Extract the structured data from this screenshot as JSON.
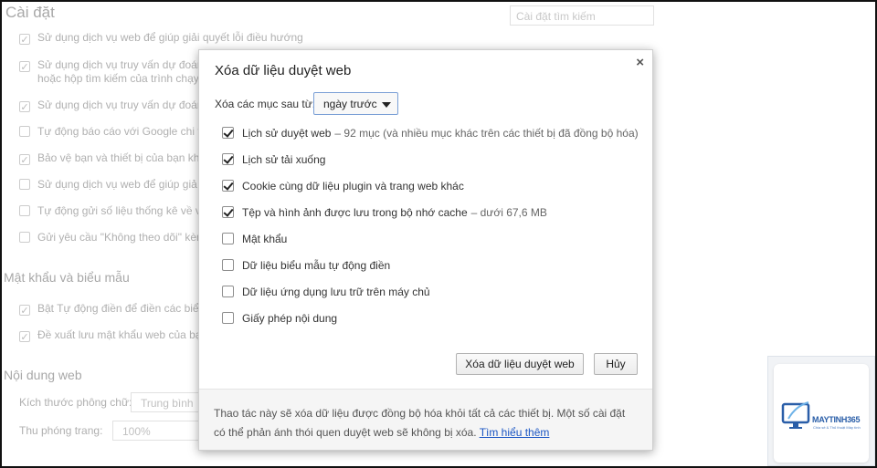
{
  "background": {
    "title": "Cài đặt",
    "search_placeholder": "Cài đặt tìm kiếm",
    "privacy_rows": [
      {
        "label": "Sử dụng dịch vụ web để giúp giải quyết lỗi điều hướng",
        "checked": true
      },
      {
        "label": "Sử dụng dịch vụ truy vấn dự đoán",
        "line2": "hoặc hộp tìm kiếm của trình chạy",
        "checked": true
      },
      {
        "label": "Sử dụng dịch vụ truy vấn dự đoán",
        "checked": true
      },
      {
        "label": "Tự động báo cáo với Google chi t",
        "checked": false
      },
      {
        "label": "Bảo vệ bạn và thiết bị của bạn kh",
        "checked": true
      },
      {
        "label": "Sử dụng dịch vụ web để giúp giả",
        "checked": false
      },
      {
        "label": "Tự động gửi số liệu thống kê về v",
        "checked": false
      },
      {
        "label": "Gửi yêu cầu \"Không theo dõi\" kèm",
        "checked": false
      }
    ],
    "passwords_heading": "Mật khẩu và biểu mẫu",
    "password_rows": [
      {
        "label": "Bật Tự động điền để điền các biể",
        "checked": true
      },
      {
        "label": "Đề xuất lưu mật khẩu web của bạ",
        "checked": true
      }
    ],
    "web_content_heading": "Nội dung web",
    "font_size_label": "Kích thước phông chữ:",
    "font_size_value": "Trung bình",
    "zoom_label": "Thu phóng trang:",
    "zoom_value": "100%"
  },
  "dialog": {
    "title": "Xóa dữ liệu duyệt web",
    "close_glyph": "×",
    "since_label": "Xóa các mục sau từ:",
    "since_value": "ngày trước",
    "options": [
      {
        "label": "Lịch sử duyệt web",
        "extra": "–  92 mục (và nhiều mục khác trên các thiết bị đã đồng bộ hóa)",
        "checked": true
      },
      {
        "label": "Lịch sử tải xuống",
        "extra": "",
        "checked": true
      },
      {
        "label": "Cookie cùng dữ liệu plugin và trang web khác",
        "extra": "",
        "checked": true
      },
      {
        "label": "Tệp và hình ảnh được lưu trong bộ nhớ cache",
        "extra": "–  dưới 67,6 MB",
        "checked": true
      },
      {
        "label": "Mật khẩu",
        "extra": "",
        "checked": false
      },
      {
        "label": "Dữ liệu biểu mẫu tự động điền",
        "extra": "",
        "checked": false
      },
      {
        "label": "Dữ liệu ứng dụng lưu trữ trên máy chủ",
        "extra": "",
        "checked": false
      },
      {
        "label": "Giấy phép nội dung",
        "extra": "",
        "checked": false
      }
    ],
    "clear_button": "Xóa dữ liệu duyệt web",
    "cancel_button": "Hủy",
    "footer_text": "Thao tác này sẽ xóa dữ liệu được đồng bộ hóa khỏi tất cả các thiết bị. Một số cài đặt có thể phản ánh thói quen duyệt web sẽ không bị xóa.",
    "footer_link": "Tìm hiểu thêm"
  },
  "watermark": {
    "brand": "MAYTINH365",
    "tagline": "Chia sẻ & Thủ thuật Máy tính"
  }
}
